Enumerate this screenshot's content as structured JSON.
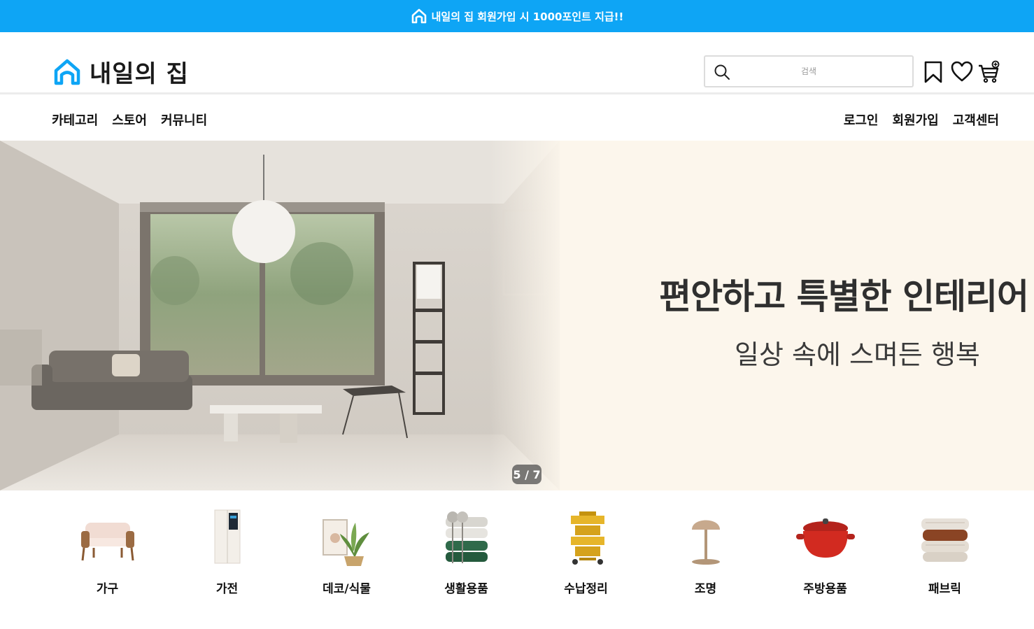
{
  "topbar": {
    "text": "내일의 집 회원가입 시 1000포인트 지급!!",
    "icon": "house-icon"
  },
  "brand": {
    "name": "내일의 집",
    "logo_icon": "house-icon",
    "color": "#0ea5f5"
  },
  "search": {
    "placeholder": "검색",
    "icon": "search-icon"
  },
  "header_icons": [
    "bookmark-icon",
    "heart-icon",
    "cart-icon"
  ],
  "nav": {
    "left": [
      "카테고리",
      "스토어",
      "커뮤니티"
    ],
    "right": [
      "로그인",
      "회원가입",
      "고객센터"
    ]
  },
  "hero": {
    "title": "편안하고 특별한 인테리어",
    "subtitle": "일상 속에 스며든 행복",
    "pager": "5 / 7",
    "background": "#fcf6ec"
  },
  "categories": [
    {
      "label": "가구",
      "icon": "sofa-icon"
    },
    {
      "label": "가전",
      "icon": "refrigerator-icon"
    },
    {
      "label": "데코/식물",
      "icon": "plant-icon"
    },
    {
      "label": "생활용품",
      "icon": "towels-icon"
    },
    {
      "label": "수납정리",
      "icon": "storage-cart-icon"
    },
    {
      "label": "조명",
      "icon": "lamp-icon"
    },
    {
      "label": "주방용품",
      "icon": "pot-icon"
    },
    {
      "label": "패브릭",
      "icon": "pillows-icon"
    }
  ]
}
